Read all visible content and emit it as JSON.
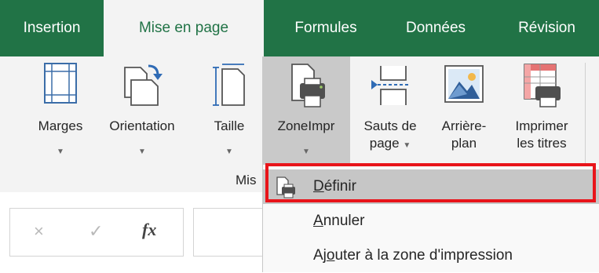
{
  "tabs": [
    {
      "label": "Insertion",
      "active": false
    },
    {
      "label": "Mise en page",
      "active": true
    },
    {
      "label": "Formules",
      "active": false
    },
    {
      "label": "Données",
      "active": false
    },
    {
      "label": "Révision",
      "active": false
    }
  ],
  "ribbon": {
    "buttons": [
      {
        "line1": "Marges",
        "line2": "",
        "icon": "margins-icon"
      },
      {
        "line1": "Orientation",
        "line2": "",
        "icon": "orientation-icon"
      },
      {
        "line1": "Taille",
        "line2": "",
        "icon": "size-icon"
      },
      {
        "line1": "ZoneImpr",
        "line2": "",
        "icon": "print-area-icon",
        "pressed": true
      },
      {
        "line1": "Sauts de",
        "line2": "page",
        "icon": "breaks-icon"
      },
      {
        "line1": "Arrière-",
        "line2": "plan",
        "icon": "background-icon"
      },
      {
        "line1": "Imprimer",
        "line2": "les titres",
        "icon": "print-titles-icon"
      }
    ],
    "group_label": "Mis"
  },
  "formula_bar": {
    "cancel": "×",
    "enter": "✓",
    "fx": "fx"
  },
  "menu": {
    "items": [
      {
        "label": "Définir",
        "accel": "D",
        "highlighted": true,
        "icon": "set-print-area-icon"
      },
      {
        "label": "Annuler",
        "accel": "A",
        "highlighted": false
      },
      {
        "label": "Ajouter à la zone d'impression",
        "accel": "o",
        "highlighted": false
      }
    ]
  },
  "colors": {
    "accent": "#217346",
    "highlight_border": "#e8141a"
  }
}
